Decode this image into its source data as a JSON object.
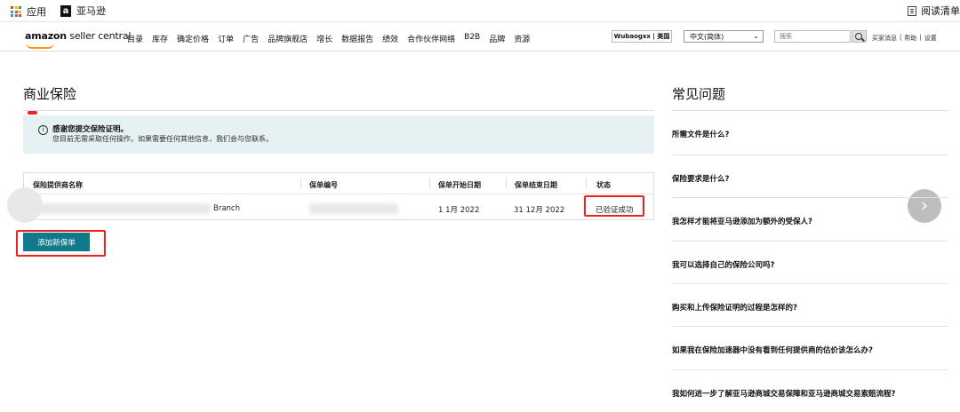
{
  "browser": {
    "apps_label": "应用",
    "amazon_bookmark": "亚马逊",
    "reader_label": "阅读清单",
    "apps_colors": [
      "#ea4335",
      "#fbbc04",
      "#34a853",
      "#4285f4",
      "#ea4335",
      "#fbbc04",
      "#34a853",
      "#4285f4",
      "#ea4335"
    ]
  },
  "nav": {
    "logo_amazon": "amazon",
    "logo_sc": " seller central",
    "menu": [
      "目录",
      "库存",
      "确定价格",
      "订单",
      "广告",
      "品牌旗舰店",
      "增长",
      "数据报告",
      "绩效",
      "合作伙伴网络",
      "B2B",
      "品牌",
      "资源"
    ],
    "account": "Wubaogxx | 美国",
    "language": "中文(简体)",
    "search_placeholder": "搜索",
    "links": [
      "买家消息",
      "帮助",
      "设置"
    ]
  },
  "main": {
    "title": "商业保险",
    "notice_title": "感谢您提交保险证明。",
    "notice_body": "您目前无需采取任何操作。如果需要任何其他信息，我们会与您联系。",
    "table": {
      "headers": [
        "保险提供商名称",
        "保单编号",
        "保单开始日期",
        "保单结束日期",
        "状态"
      ],
      "row": {
        "provider_suffix": "Branch",
        "start_date": "1 1月 2022",
        "end_date": "31 12月 2022",
        "status": "已验证成功"
      }
    },
    "add_button": "添加新保单"
  },
  "faq": {
    "title": "常见问题",
    "items": [
      "所需文件是什么?",
      "保险要求是什么?",
      "我怎样才能将亚马逊添加为额外的受保人?",
      "我可以选择自己的保险公司吗?",
      "购买和上传保险证明的过程是怎样的?",
      "如果我在保险加速器中没有看到任何提供商的估价该怎么办?",
      "我如何进一步了解亚马逊商城交易保障和亚马逊商城交易索赔流程?"
    ]
  }
}
